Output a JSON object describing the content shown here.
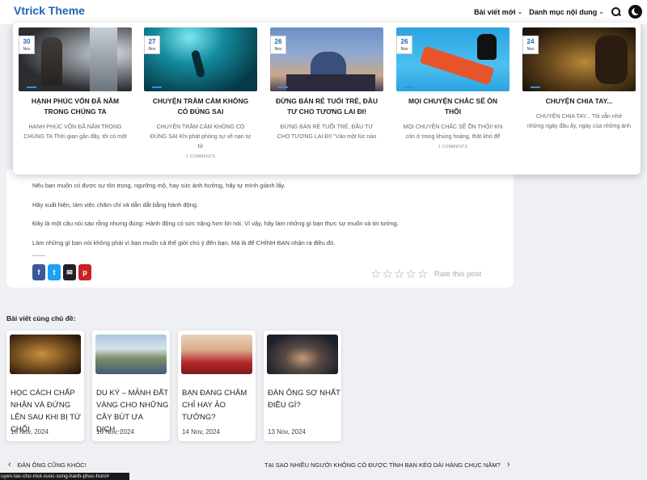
{
  "header": {
    "brand": "Vtrick Theme",
    "nav_latest": "Bài viết mới",
    "nav_categories": "Danh mục nội dung"
  },
  "dropdown_posts": [
    {
      "day": "30",
      "month": "Nov",
      "title": "HẠNH PHÚC VỐN ĐÃ NẰM TRONG CHÚNG TA",
      "excerpt": "HẠNH PHÚC VỐN ĐÃ NẰM TRONG CHÚNG TA Thời gian gần đây, tôi có một",
      "comments": ""
    },
    {
      "day": "27",
      "month": "Nov",
      "title": "CHUYỆN TRẦM CẢM KHÔNG CÓ ĐÚNG SAI",
      "excerpt": "CHUYỆN TRẦM CẢM KHÔNG CÓ ĐÚNG SAI Khi phát phòng sự về nạn tự tử",
      "comments": "1 COMMENTS"
    },
    {
      "day": "26",
      "month": "Nov",
      "title": "ĐỪNG BÁN RẺ TUỔI TRẺ, ĐẦU TƯ CHO TƯƠNG LAI ĐI!",
      "excerpt": "ĐỪNG BÁN RẺ TUỔI TRẺ, ĐẦU TƯ CHO TƯƠNG LAI ĐI! \"Vào một lúc nào",
      "comments": ""
    },
    {
      "day": "26",
      "month": "Nov",
      "title": "MỌI CHUYỆN CHẮC SẼ ỔN THÔI",
      "excerpt": "MỌI CHUYỆN CHẮC SẼ ỔN THÔI! Khi còn ở trong khủng hoảng, thật khó để",
      "comments": "1 COMMENTS"
    },
    {
      "day": "24",
      "month": "Nov",
      "title": "CHUYỆN CHIA TAY...",
      "excerpt": "CHUYỆN CHIA TAY... Tôi vẫn nhớ những ngày đầu ấy, ngày của những ánh",
      "comments": ""
    }
  ],
  "article": {
    "paragraphs": [
      "Nếu bạn muốn có được sự tôn trọng, ngưỡng mộ, hay sức ảnh hưởng, hãy tự mình giành lấy.",
      "Hãy xuất hiện, làm việc chăm chỉ và dẫn dắt bằng hành động.",
      "Đây là một câu nói sáo rỗng nhưng đúng: Hành động có sức nặng hơn lời nói. Vì vậy, hãy làm những gì bạn thực sự muốn và tin tưởng.",
      "Làm những gì bạn nói không phải vì bạn muốn cả thế giới chú ý đến bạn. Mà là để CHÍNH BẠN nhận ra điều đó."
    ],
    "share_buttons": [
      {
        "icon": "facebook-icon",
        "glyph": "f",
        "color": "#3b5998"
      },
      {
        "icon": "twitter-icon",
        "glyph": "t",
        "color": "#1da1f2"
      },
      {
        "icon": "email-icon",
        "glyph": "✉",
        "color": "#222222"
      },
      {
        "icon": "pinterest-icon",
        "glyph": "p",
        "color": "#cb2027"
      }
    ],
    "rating": 0,
    "rating_max": 5,
    "rate_label": "Rate this post"
  },
  "related": {
    "heading": "Bài viết cùng chủ đề:",
    "posts": [
      {
        "title": "HỌC CÁCH CHẤP NHẬN VÀ ĐỨNG LÊN SAU KHI BỊ TỪ CHỐI",
        "date": "16 Nov, 2024"
      },
      {
        "title": "DU KÝ – MẢNH ĐẤT VÀNG CHO NHỮNG CÂY BÚT ƯA DỊCH...",
        "date": "16 Nov, 2024"
      },
      {
        "title": "BẠN ĐANG CHĂM CHỈ HAY ẢO TƯỞNG?",
        "date": "14 Nov, 2024"
      },
      {
        "title": "ĐÀN ÔNG SỢ NHẤT ĐIỀU GÌ?",
        "date": "13 Nov, 2024"
      }
    ]
  },
  "post_nav": {
    "prev": "ĐÀN ÔNG CŨNG KHÓC!",
    "next": "TẠI SAO NHIỀU NGƯỜI KHÔNG CÓ ĐƯỢC TÌNH BẠN KÉO DÀI HÀNG CHỤC NĂM?"
  },
  "status_url": "uyen-tac-cho-mot-cuoc-song-hanh-phuc-hon/#"
}
